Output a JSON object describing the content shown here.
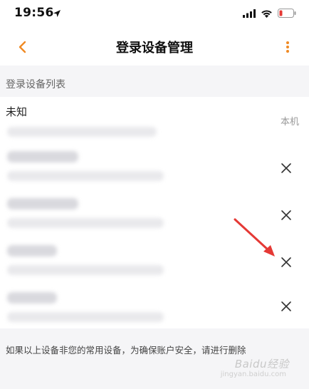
{
  "status_bar": {
    "time": "19:56",
    "icons": [
      "location-arrow-icon",
      "signal-icon",
      "wifi-icon",
      "battery-low-icon"
    ],
    "battery_color": "#e53935"
  },
  "navbar": {
    "title": "登录设备管理",
    "back_icon": "chevron-left-icon",
    "more_icon": "more-vertical-icon",
    "accent_color": "#f08a24"
  },
  "section": {
    "header": "登录设备列表"
  },
  "devices": [
    {
      "name": "未知",
      "badge": "本机"
    },
    {
      "name": "",
      "action_icon": "close-icon"
    },
    {
      "name": "",
      "action_icon": "close-icon"
    },
    {
      "name": "",
      "action_icon": "close-icon"
    },
    {
      "name": "",
      "action_icon": "close-icon"
    }
  ],
  "footer": {
    "note": "如果以上设备非您的常用设备，为确保账户安全，请进行删除"
  },
  "watermark": {
    "text": "Baidu经验",
    "sub": "jingyan.baidu.com"
  },
  "annotation": {
    "icon": "red-arrow-icon",
    "color": "#e53935"
  }
}
